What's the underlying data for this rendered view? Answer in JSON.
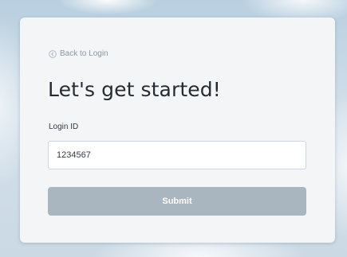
{
  "back_link": {
    "label": "Back to Login",
    "icon": "back-circle-icon"
  },
  "heading": {
    "title": "Let's get started!"
  },
  "login_form": {
    "field_label": "Login ID",
    "field_value": "1234567",
    "submit_label": "Submit"
  },
  "colors": {
    "submit_background": "#a9b5bf",
    "card_background": "#f4f5f7",
    "heading_text": "#262b33",
    "link_text": "#8b97a3"
  }
}
